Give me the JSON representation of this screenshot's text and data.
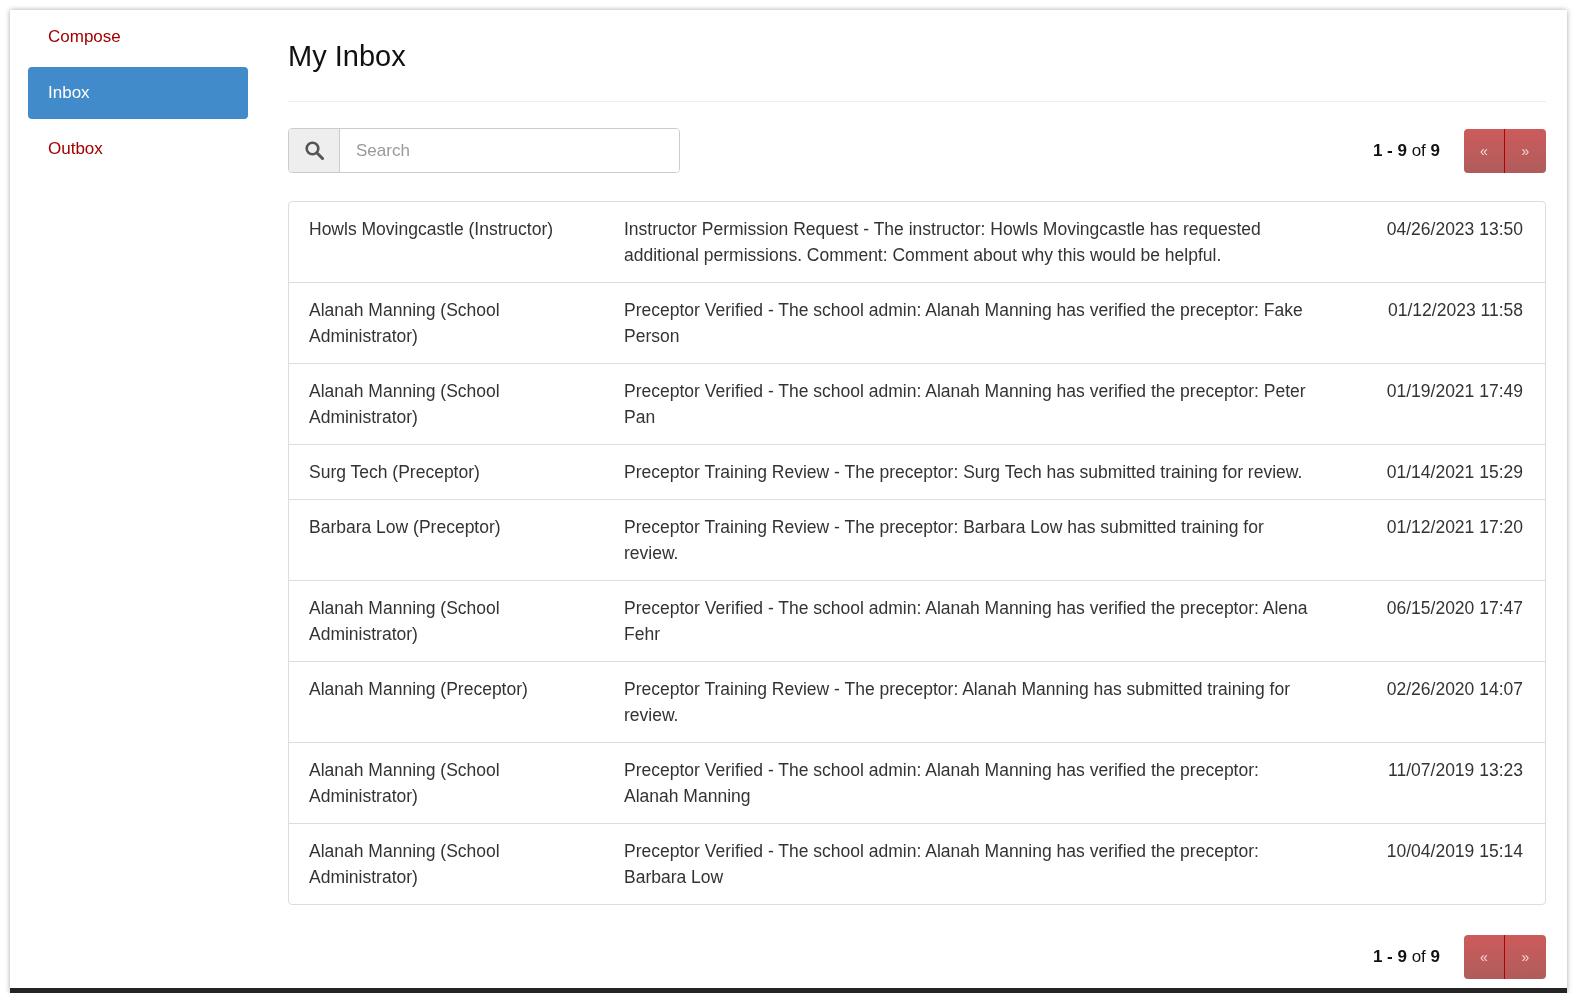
{
  "sidebar": {
    "items": [
      {
        "label": "Compose",
        "selected": false
      },
      {
        "label": "Inbox",
        "selected": true
      },
      {
        "label": "Outbox",
        "selected": false
      }
    ]
  },
  "header": {
    "title": "My Inbox"
  },
  "toolbar_top": {
    "search": {
      "placeholder": "Search"
    },
    "pagination": {
      "count": "**1 - 9** of **9**",
      "previous": "«",
      "next": "»"
    }
  },
  "messages": [
    {
      "sender": "Howls Movingcastle (Instructor)",
      "text": "Instructor Permission Request - The instructor: Howls Movingcastle has requested additional permissions. Comment: Comment about why this would be helpful.",
      "date": "04/26/2023 13:50"
    },
    {
      "sender": "Alanah Manning (School Administrator)",
      "text": "Preceptor Verified - The school admin: Alanah Manning has verified the preceptor: Fake Person",
      "date": "01/12/2023 11:58"
    },
    {
      "sender": "Alanah Manning (School Administrator)",
      "text": "Preceptor Verified - The school admin: Alanah Manning has verified the preceptor: Peter Pan",
      "date": "01/19/2021 17:49"
    },
    {
      "sender": "Surg Tech (Preceptor)",
      "text": "Preceptor Training Review - The preceptor: Surg Tech has submitted training for review.",
      "date": "01/14/2021 15:29"
    },
    {
      "sender": "Barbara Low (Preceptor)",
      "text": "Preceptor Training Review - The preceptor: Barbara Low has submitted training for review.",
      "date": "01/12/2021 17:20"
    },
    {
      "sender": "Alanah Manning (School Administrator)",
      "text": "Preceptor Verified - The school admin: Alanah Manning has verified the preceptor: Alena Fehr",
      "date": "06/15/2020 17:47"
    },
    {
      "sender": "Alanah Manning (Preceptor)",
      "text": "Preceptor Training Review - The preceptor: Alanah Manning has submitted training for review.",
      "date": "02/26/2020 14:07"
    },
    {
      "sender": "Alanah Manning (School Administrator)",
      "text": "Preceptor Verified - The school admin: Alanah Manning has verified the preceptor: Alanah Manning",
      "date": "11/07/2019 13:23"
    },
    {
      "sender": "Alanah Manning (School Administrator)",
      "text": "Preceptor Verified - The school admin: Alanah Manning has verified the preceptor: Barbara Low",
      "date": "10/04/2019 15:14"
    }
  ],
  "toolbar_bottom": {
    "pagination": {
      "count": "**1 - 9** of **9**",
      "previous": "«",
      "next": "»"
    }
  }
}
